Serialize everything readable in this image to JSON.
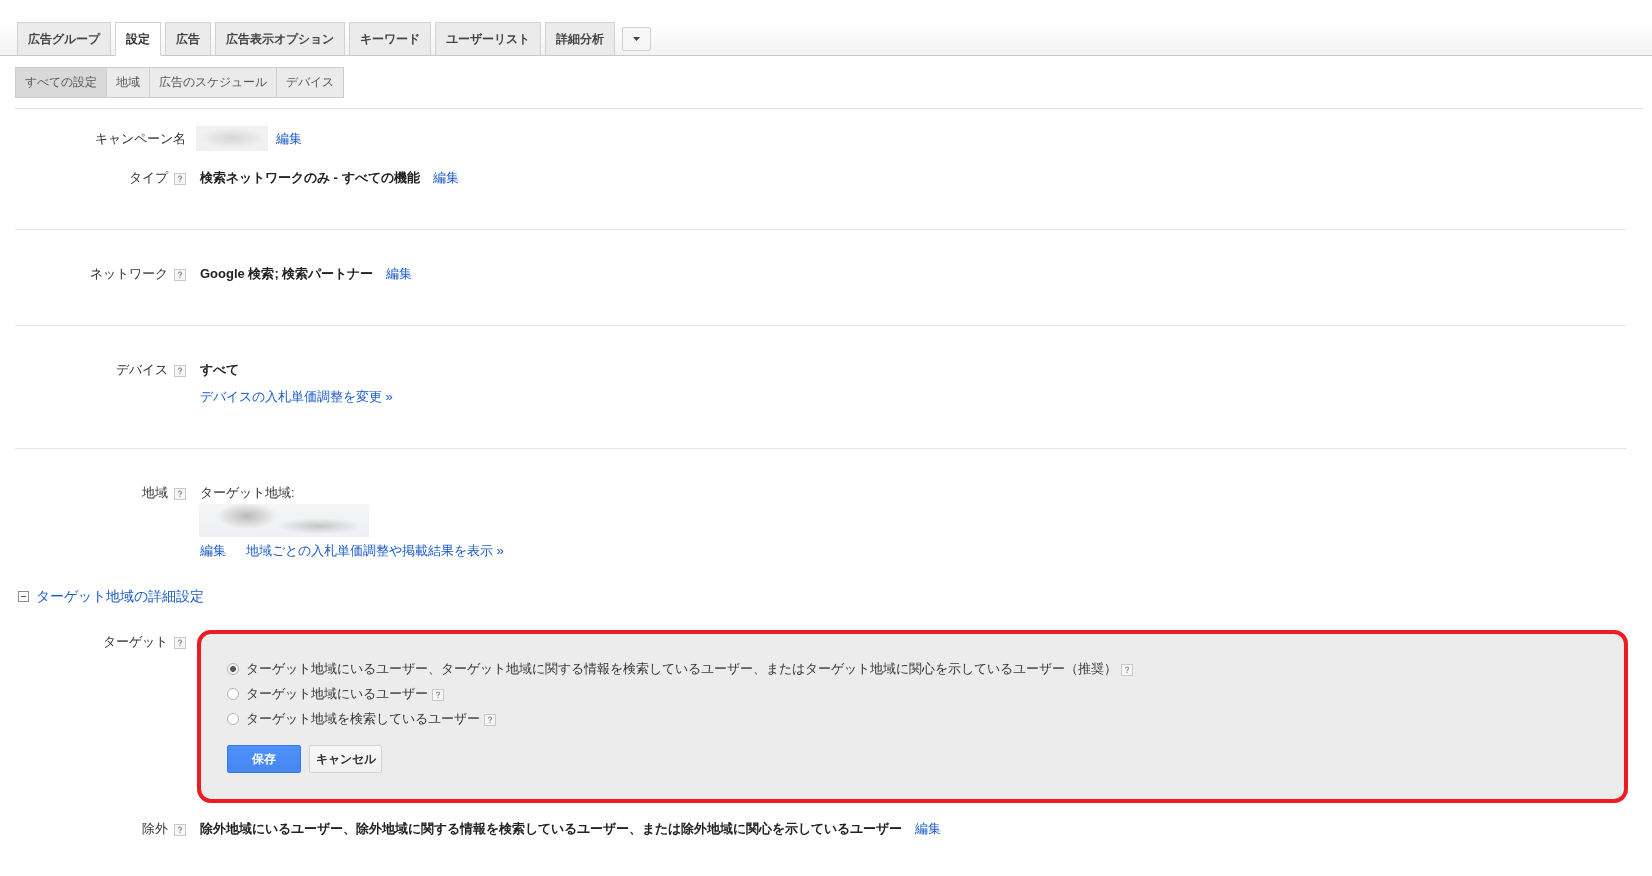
{
  "tabs": [
    {
      "label": "広告グループ",
      "selected": false
    },
    {
      "label": "設定",
      "selected": true
    },
    {
      "label": "広告",
      "selected": false
    },
    {
      "label": "広告表示オプション",
      "selected": false
    },
    {
      "label": "キーワード",
      "selected": false
    },
    {
      "label": "ユーザーリスト",
      "selected": false
    },
    {
      "label": "詳細分析",
      "selected": false
    }
  ],
  "subtabs": [
    {
      "label": "すべての設定",
      "selected": true
    },
    {
      "label": "地域",
      "selected": false
    },
    {
      "label": "広告のスケジュール",
      "selected": false
    },
    {
      "label": "デバイス",
      "selected": false
    }
  ],
  "sections": [
    {
      "rows": [
        {
          "kind": "inline",
          "label": "キャンペーン名",
          "help": false,
          "blurred": true,
          "links": [
            "編集"
          ]
        },
        {
          "kind": "inline",
          "label": "タイプ",
          "help": true,
          "blurred": false,
          "value": "検索ネットワークのみ - すべての機能",
          "links": [
            "編集"
          ]
        }
      ]
    },
    {
      "rows": [
        {
          "kind": "inline",
          "label": "ネットワーク",
          "help": true,
          "blurred": false,
          "value": "Google 検索; 検索パートナー",
          "links": [
            "編集"
          ]
        }
      ]
    },
    {
      "rows": [
        {
          "kind": "stacked",
          "label": "デバイス",
          "help": true,
          "blurred": false,
          "value": "すべて",
          "links": [
            "デバイスの入札単価調整を変更 »"
          ]
        }
      ]
    },
    {
      "rows": [
        {
          "kind": "location",
          "label": "地域",
          "help": true,
          "blurred": true,
          "value": "ターゲット地域:",
          "links": [
            "編集",
            "地域ごとの入札単価調整や掲載結果を表示 »"
          ]
        }
      ]
    }
  ],
  "advanced": {
    "label": "ターゲット地域の詳細設定",
    "expanded": true
  },
  "target": {
    "label": "ターゲット",
    "help": true,
    "options": [
      {
        "label": "ターゲット地域にいるユーザー、ターゲット地域に関する情報を検索しているユーザー、またはターゲット地域に関心を示しているユーザー（推奨）",
        "selected": true,
        "help": true
      },
      {
        "label": "ターゲット地域にいるユーザー",
        "selected": false,
        "help": true
      },
      {
        "label": "ターゲット地域を検索しているユーザー",
        "selected": false,
        "help": true
      }
    ],
    "buttons": [
      {
        "label": "保存",
        "kind": "primary"
      },
      {
        "label": "キャンセル",
        "kind": "secondary"
      }
    ]
  },
  "exclusion": {
    "kind": "inline",
    "label": "除外",
    "help": true,
    "blurred": false,
    "value": "除外地域にいるユーザー、除外地域に関する情報を検索しているユーザー、または除外地域に関心を示しているユーザー",
    "links": [
      "編集"
    ]
  }
}
